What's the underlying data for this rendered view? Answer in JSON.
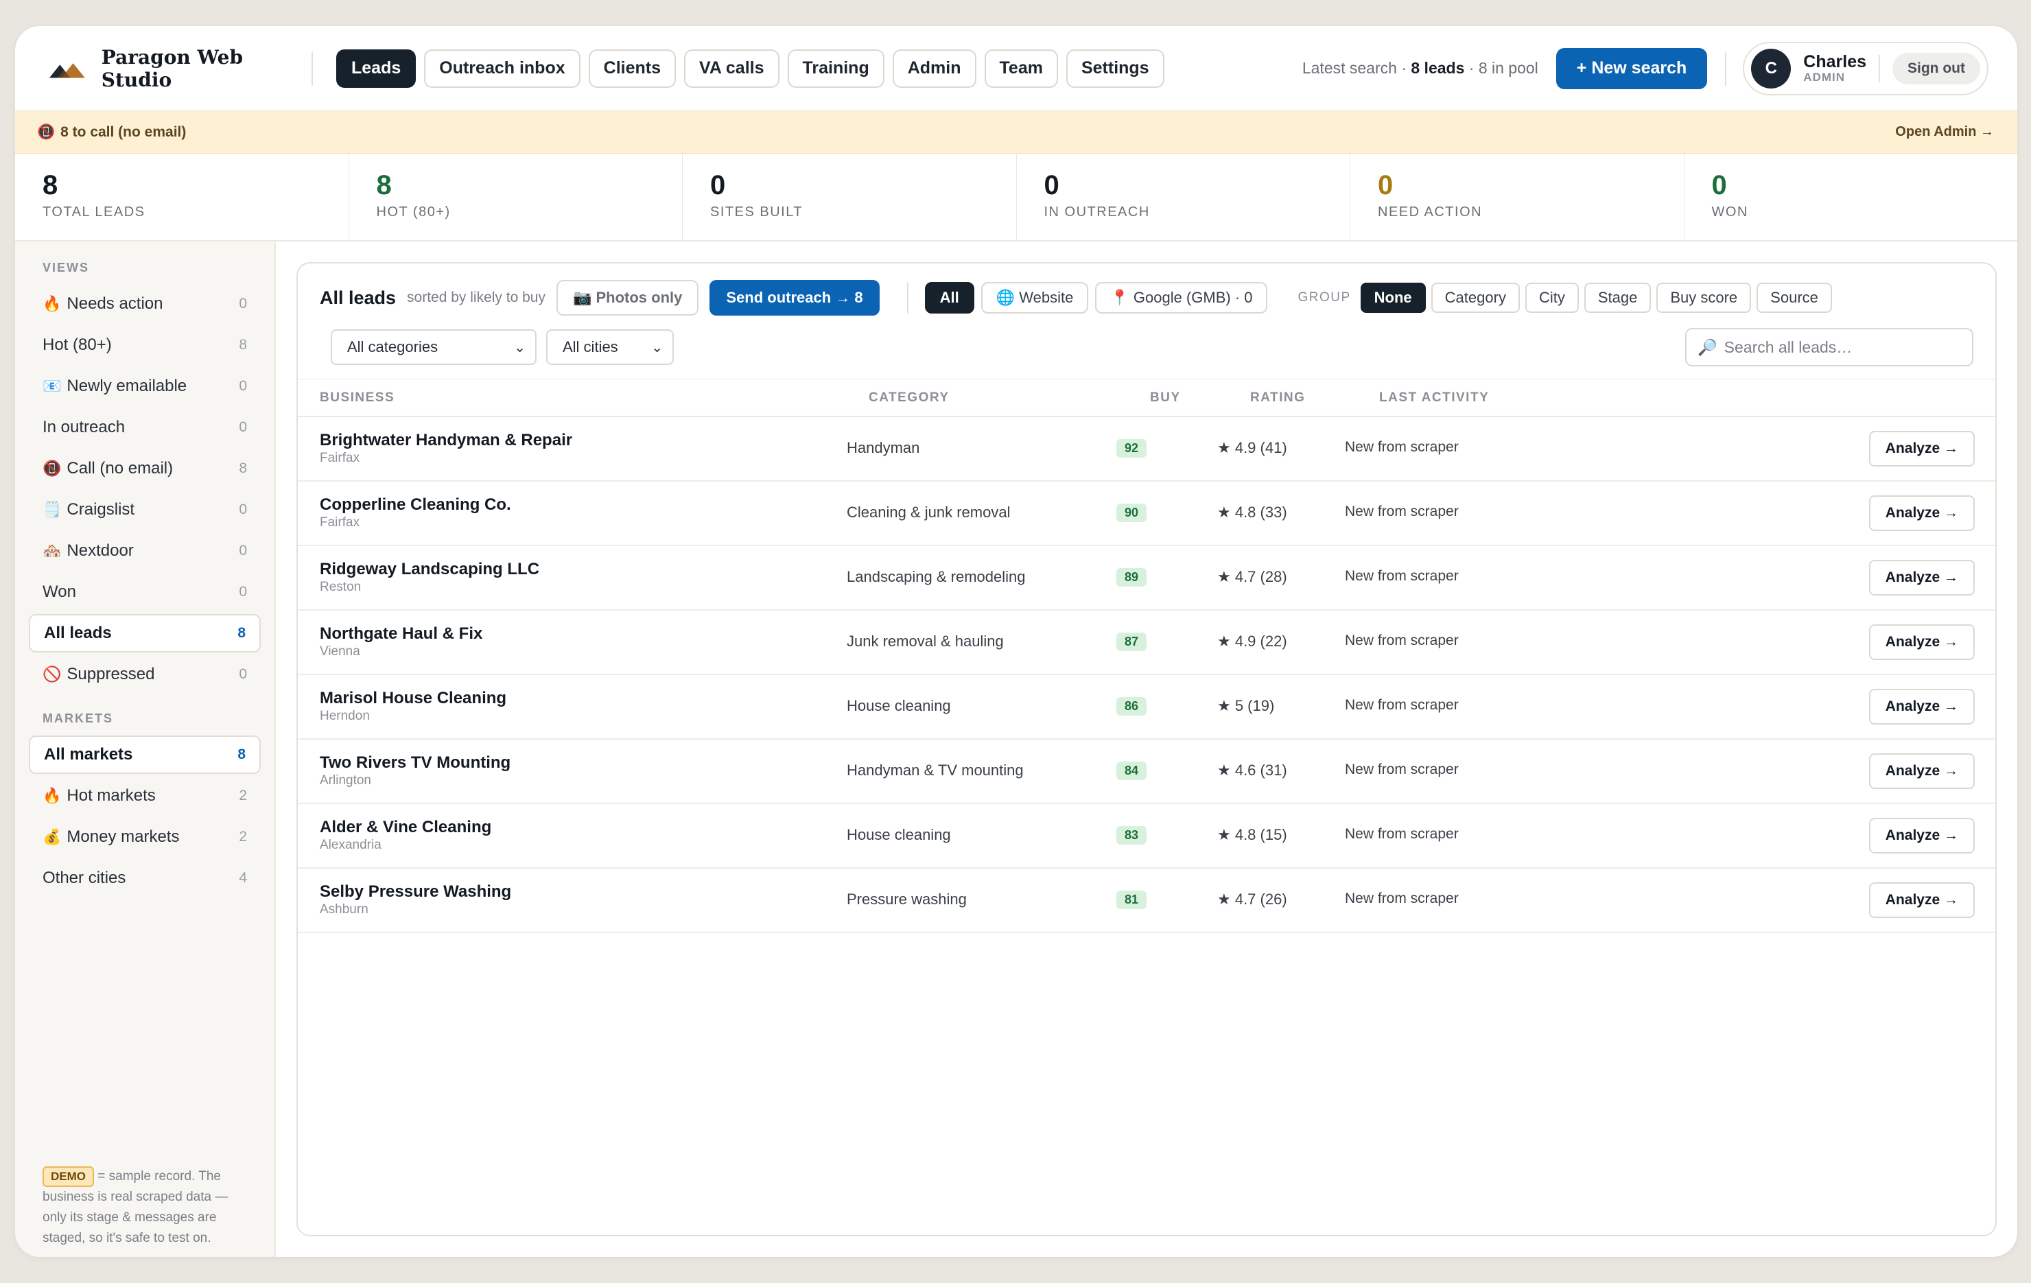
{
  "header": {
    "brand": "Paragon Web Studio",
    "nav": [
      {
        "label": "Leads",
        "active": true
      },
      {
        "label": "Outreach inbox",
        "active": false
      },
      {
        "label": "Clients",
        "active": false
      },
      {
        "label": "VA calls",
        "active": false
      },
      {
        "label": "Training",
        "active": false
      },
      {
        "label": "Admin",
        "active": false
      },
      {
        "label": "Team",
        "active": false
      },
      {
        "label": "Settings",
        "active": false
      }
    ],
    "latest_prefix": "Latest search · ",
    "latest_leads": "8 leads",
    "latest_pool": " · 8 in pool",
    "new_search_label": "+ New search",
    "user": {
      "initial": "C",
      "name": "Charles",
      "role": "ADMIN"
    },
    "signout_label": "Sign out"
  },
  "banner": {
    "icon": "no-mobile-icon",
    "text": "8 to call (no email)",
    "link": "Open Admin →"
  },
  "stats": [
    {
      "value": "8",
      "label": "TOTAL LEADS",
      "color": "#141a22"
    },
    {
      "value": "8",
      "label": "HOT (80+)",
      "color": "#1b6e3a"
    },
    {
      "value": "0",
      "label": "SITES BUILT",
      "color": "#141a22"
    },
    {
      "value": "0",
      "label": "IN OUTREACH",
      "color": "#141a22"
    },
    {
      "value": "0",
      "label": "NEED ACTION",
      "color": "#a87a12"
    },
    {
      "value": "0",
      "label": "WON",
      "color": "#1b6e3a"
    }
  ],
  "sidebar": {
    "views_heading": "VIEWS",
    "views": [
      {
        "emoji": "🔥",
        "label": "Needs action",
        "count": "0"
      },
      {
        "emoji": "",
        "label": "Hot (80+)",
        "count": "8"
      },
      {
        "emoji": "📧",
        "label": "Newly emailable",
        "count": "0"
      },
      {
        "emoji": "",
        "label": "In outreach",
        "count": "0"
      },
      {
        "emoji": "📵",
        "label": "Call (no email)",
        "count": "8"
      },
      {
        "emoji": "🗒️",
        "label": "Craigslist",
        "count": "0"
      },
      {
        "emoji": "🏘️",
        "label": "Nextdoor",
        "count": "0"
      },
      {
        "emoji": "",
        "label": "Won",
        "count": "0"
      },
      {
        "emoji": "",
        "label": "All leads",
        "count": "8",
        "active": true
      },
      {
        "emoji": "🚫",
        "label": "Suppressed",
        "count": "0"
      }
    ],
    "markets_heading": "MARKETS",
    "markets": [
      {
        "emoji": "",
        "label": "All markets",
        "count": "8",
        "active": true
      },
      {
        "emoji": "🔥",
        "label": "Hot markets",
        "count": "2"
      },
      {
        "emoji": "💰",
        "label": "Money markets",
        "count": "2"
      },
      {
        "emoji": "",
        "label": "Other cities",
        "count": "4"
      }
    ],
    "demo_badge": "DEMO",
    "demo_text": " = sample record. The business is real scraped data — only its stage & messages are staged, so it's safe to test on."
  },
  "main": {
    "title": "All leads",
    "subtitle": "sorted by likely to buy",
    "photos_only": "📷 Photos only",
    "send_outreach": "Send outreach → 8",
    "source_filters": [
      {
        "label": "All",
        "active": true
      },
      {
        "label": "🌐 Website",
        "active": false
      },
      {
        "label": "📍 Google (GMB) · 0",
        "active": false
      }
    ],
    "group_label": "GROUP",
    "group_options": [
      {
        "label": "None",
        "active": true
      },
      {
        "label": "Category",
        "active": false
      },
      {
        "label": "City",
        "active": false
      },
      {
        "label": "Stage",
        "active": false
      },
      {
        "label": "Buy score",
        "active": false
      },
      {
        "label": "Source",
        "active": false
      }
    ],
    "category_select": "All categories",
    "city_select": "All cities",
    "search_placeholder": "Search all leads…",
    "columns": {
      "business": "BUSINESS",
      "category": "CATEGORY",
      "buy": "BUY",
      "rating": "RATING",
      "activity": "LAST ACTIVITY"
    },
    "analyze_label": "Analyze →",
    "rows": [
      {
        "name": "Brightwater Handyman & Repair",
        "city": "Fairfax",
        "category": "Handyman",
        "buy": "92",
        "rating": "★ 4.9 (41)",
        "activity": "New from scraper"
      },
      {
        "name": "Copperline Cleaning Co.",
        "city": "Fairfax",
        "category": "Cleaning & junk removal",
        "buy": "90",
        "rating": "★ 4.8 (33)",
        "activity": "New from scraper"
      },
      {
        "name": "Ridgeway Landscaping LLC",
        "city": "Reston",
        "category": "Landscaping & remodeling",
        "buy": "89",
        "rating": "★ 4.7 (28)",
        "activity": "New from scraper"
      },
      {
        "name": "Northgate Haul & Fix",
        "city": "Vienna",
        "category": "Junk removal & hauling",
        "buy": "87",
        "rating": "★ 4.9 (22)",
        "activity": "New from scraper"
      },
      {
        "name": "Marisol House Cleaning",
        "city": "Herndon",
        "category": "House cleaning",
        "buy": "86",
        "rating": "★ 5 (19)",
        "activity": "New from scraper"
      },
      {
        "name": "Two Rivers TV Mounting",
        "city": "Arlington",
        "category": "Handyman & TV mounting",
        "buy": "84",
        "rating": "★ 4.6 (31)",
        "activity": "New from scraper"
      },
      {
        "name": "Alder & Vine Cleaning",
        "city": "Alexandria",
        "category": "House cleaning",
        "buy": "83",
        "rating": "★ 4.8 (15)",
        "activity": "New from scraper"
      },
      {
        "name": "Selby Pressure Washing",
        "city": "Ashburn",
        "category": "Pressure washing",
        "buy": "81",
        "rating": "★ 4.7 (26)",
        "activity": "New from scraper"
      }
    ]
  }
}
